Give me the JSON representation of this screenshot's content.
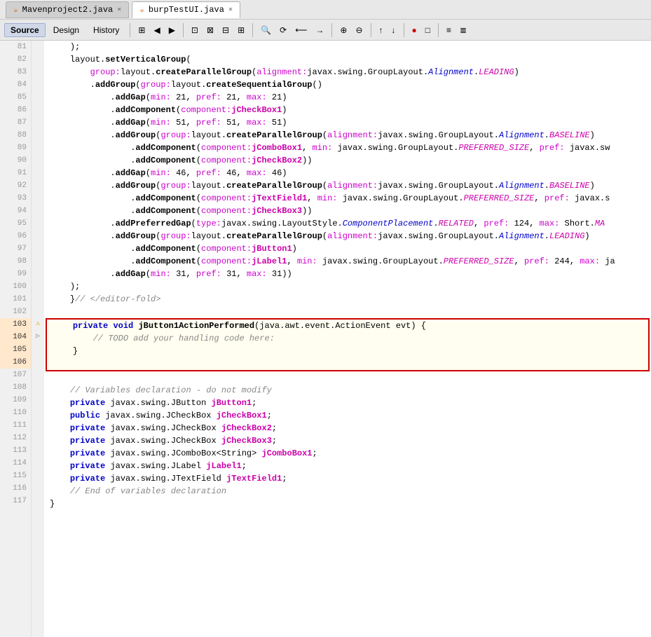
{
  "titleBar": {
    "tabs": [
      {
        "id": "mavenproject",
        "label": "Mavenproject2.java",
        "active": false,
        "icon": "J"
      },
      {
        "id": "burptest",
        "label": "burpTestUI.java",
        "active": true,
        "icon": "J"
      }
    ]
  },
  "toolbar": {
    "items": [
      {
        "id": "source",
        "label": "Source",
        "active": true
      },
      {
        "id": "design",
        "label": "Design",
        "active": false
      },
      {
        "id": "history",
        "label": "History",
        "active": false
      }
    ],
    "icons": [
      "⊞",
      "◀",
      "▶",
      "⊡",
      "⊠",
      "⊟",
      "⊞",
      "🔍",
      "⟳",
      "⟵",
      "→",
      "⊕",
      "⊖",
      "⊗",
      "↑",
      "↓",
      "⊙",
      "▷",
      "□",
      "≡",
      "≣"
    ]
  },
  "lines": [
    {
      "num": 81,
      "indent": 2,
      "code": "    );"
    },
    {
      "num": 82,
      "indent": 2,
      "code": "    layout.setVerticalGroup("
    },
    {
      "num": 83,
      "indent": 3,
      "code": "        <span class='param-name'>group:</span>layout.createParallelGroup(<span class='param-name'>alignment:</span>javax.swing.GroupLayout.<span class='italic-kw'>Alignment</span>.<span class='italic-pink'>LEADING</span>)"
    },
    {
      "num": 84,
      "indent": 3,
      "code": "        .addGroup(<span class='param-name'>group:</span>layout.createSequentialGroup()"
    },
    {
      "num": 85,
      "indent": 4,
      "code": "            .addGap(<span class='param-name'>min:</span> 21, <span class='param-name'> pref:</span> 21, <span class='param-name'> max:</span> 21)"
    },
    {
      "num": 86,
      "indent": 4,
      "code": "            .addComponent(<span class='param-name'>component:</span><span class='pink'>jCheckBox1</span>)"
    },
    {
      "num": 87,
      "indent": 4,
      "code": "            .addGap(<span class='param-name'>min:</span> 51, <span class='param-name'> pref:</span> 51, <span class='param-name'> max:</span> 51)"
    },
    {
      "num": 88,
      "indent": 4,
      "code": "            .addGroup(<span class='param-name'>group:</span>layout.createParallelGroup(<span class='param-name'>alignment:</span>javax.swing.GroupLayout.<span class='italic-kw'>Alignment</span>.<span class='italic-pink'>BASELINE</span>)"
    },
    {
      "num": 89,
      "indent": 5,
      "code": "                .addComponent(<span class='param-name'>component:</span><span class='pink'>jComboBox1</span>, <span class='param-name'>min:</span> javax.swing.GroupLayout.<span class='italic-pink'>PREFERRED_SIZE</span>, <span class='param-name'>pref:</span> javax.sw"
    },
    {
      "num": 90,
      "indent": 5,
      "code": "                .addComponent(<span class='param-name'>component:</span><span class='pink'>jCheckBox2</span>))"
    },
    {
      "num": 91,
      "indent": 4,
      "code": "            .addGap(<span class='param-name'>min:</span> 46, <span class='param-name'> pref:</span> 46, <span class='param-name'> max:</span> 46)"
    },
    {
      "num": 92,
      "indent": 4,
      "code": "            .addGroup(<span class='param-name'>group:</span>layout.createParallelGroup(<span class='param-name'>alignment:</span>javax.swing.GroupLayout.<span class='italic-kw'>Alignment</span>.<span class='italic-pink'>BASELINE</span>)"
    },
    {
      "num": 93,
      "indent": 5,
      "code": "                .addComponent(<span class='param-name'>component:</span><span class='pink'>jTextField1</span>, <span class='param-name'>min:</span> javax.swing.GroupLayout.<span class='italic-pink'>PREFERRED_SIZE</span>, <span class='param-name'>pref:</span> javax.s"
    },
    {
      "num": 94,
      "indent": 5,
      "code": "                .addComponent(<span class='param-name'>component:</span><span class='pink'>jCheckBox3</span>))"
    },
    {
      "num": 95,
      "indent": 4,
      "code": "            .addPreferredGap(<span class='param-name'>type:</span>javax.swing.LayoutStyle.<span class='italic-kw'>ComponentPlacement</span>.<span class='italic-pink'>RELATED</span>, <span class='param-name'> pref:</span> 124, <span class='param-name'> max:</span> Short.<span class='italic-pink'>MA</span>"
    },
    {
      "num": 96,
      "indent": 4,
      "code": "            .addGroup(<span class='param-name'>group:</span>layout.createParallelGroup(<span class='param-name'>alignment:</span>javax.swing.GroupLayout.<span class='italic-kw'>Alignment</span>.<span class='italic-pink'>LEADING</span>)"
    },
    {
      "num": 97,
      "indent": 5,
      "code": "                .addComponent(<span class='param-name'>component:</span><span class='pink'>jButton1</span>)"
    },
    {
      "num": 98,
      "indent": 5,
      "code": "                .addComponent(<span class='param-name'>component:</span><span class='pink'>jLabel1</span>, <span class='param-name'>min:</span> javax.swing.GroupLayout.<span class='italic-pink'>PREFERRED_SIZE</span>, <span class='param-name'>pref:</span> 244, <span class='param-name'> max:</span> ja"
    },
    {
      "num": 99,
      "indent": 4,
      "code": "            .addGap(<span class='param-name'>min:</span> 31, <span class='param-name'> pref:</span> 31, <span class='param-name'> max:</span> 31))"
    },
    {
      "num": 100,
      "indent": 2,
      "code": "    );"
    },
    {
      "num": 101,
      "indent": 2,
      "code": "    }// &lt;/editor-fold&gt;"
    },
    {
      "num": 102,
      "indent": 0,
      "code": ""
    },
    {
      "num": 103,
      "indent": 2,
      "code": "    <span class='kw'>private</span> <span class='kw'>void</span> <span class='method'>jButton1ActionPerformed</span>(java.awt.event.ActionEvent evt) {",
      "highlight": true,
      "method": true
    },
    {
      "num": 104,
      "indent": 3,
      "code": "        <span class='comment'>// TODO add your handling code here:</span>",
      "method": true
    },
    {
      "num": 105,
      "indent": 2,
      "code": "    }",
      "method": true
    },
    {
      "num": 106,
      "indent": 0,
      "code": "",
      "method": true
    },
    {
      "num": 107,
      "indent": 0,
      "code": ""
    },
    {
      "num": 108,
      "indent": 2,
      "code": "    <span class='comment'>// Variables declaration - do not modify</span>"
    },
    {
      "num": 109,
      "indent": 2,
      "code": "    <span class='kw'>private</span> javax.swing.JButton <span class='pink'>jButton1</span>;"
    },
    {
      "num": 110,
      "indent": 2,
      "code": "    <span class='kw'>public</span> javax.swing.JCheckBox <span class='pink'>jCheckBox1</span>;"
    },
    {
      "num": 111,
      "indent": 2,
      "code": "    <span class='kw'>private</span> javax.swing.JCheckBox <span class='pink'>jCheckBox2</span>;"
    },
    {
      "num": 112,
      "indent": 2,
      "code": "    <span class='kw'>private</span> javax.swing.JCheckBox <span class='pink'>jCheckBox3</span>;"
    },
    {
      "num": 113,
      "indent": 2,
      "code": "    <span class='kw'>private</span> javax.swing.JComboBox&lt;String&gt; <span class='pink'>jComboBox1</span>;"
    },
    {
      "num": 114,
      "indent": 2,
      "code": "    <span class='kw'>private</span> javax.swing.JLabel <span class='pink'>jLabel1</span>;"
    },
    {
      "num": 115,
      "indent": 2,
      "code": "    <span class='kw'>private</span> javax.swing.JTextField <span class='pink'>jTextField1</span>;"
    },
    {
      "num": 116,
      "indent": 2,
      "code": "    <span class='comment'>// End of variables declaration</span>"
    },
    {
      "num": 117,
      "indent": 0,
      "code": "}"
    }
  ],
  "methodBlockLines": [
    103,
    104,
    105,
    106
  ],
  "colors": {
    "background": "#ffffff",
    "gutterBg": "#f0f0f0",
    "highlightedLine": "#fff8e0",
    "methodBlock": "#fffef5",
    "redBorder": "#cc0000",
    "keywordColor": "#0000cc",
    "methodColor": "#000000",
    "commentColor": "#888888",
    "paramNameColor": "#cc00aa",
    "pinkColor": "#cc00aa",
    "italicKeyword": "#0000cc"
  }
}
